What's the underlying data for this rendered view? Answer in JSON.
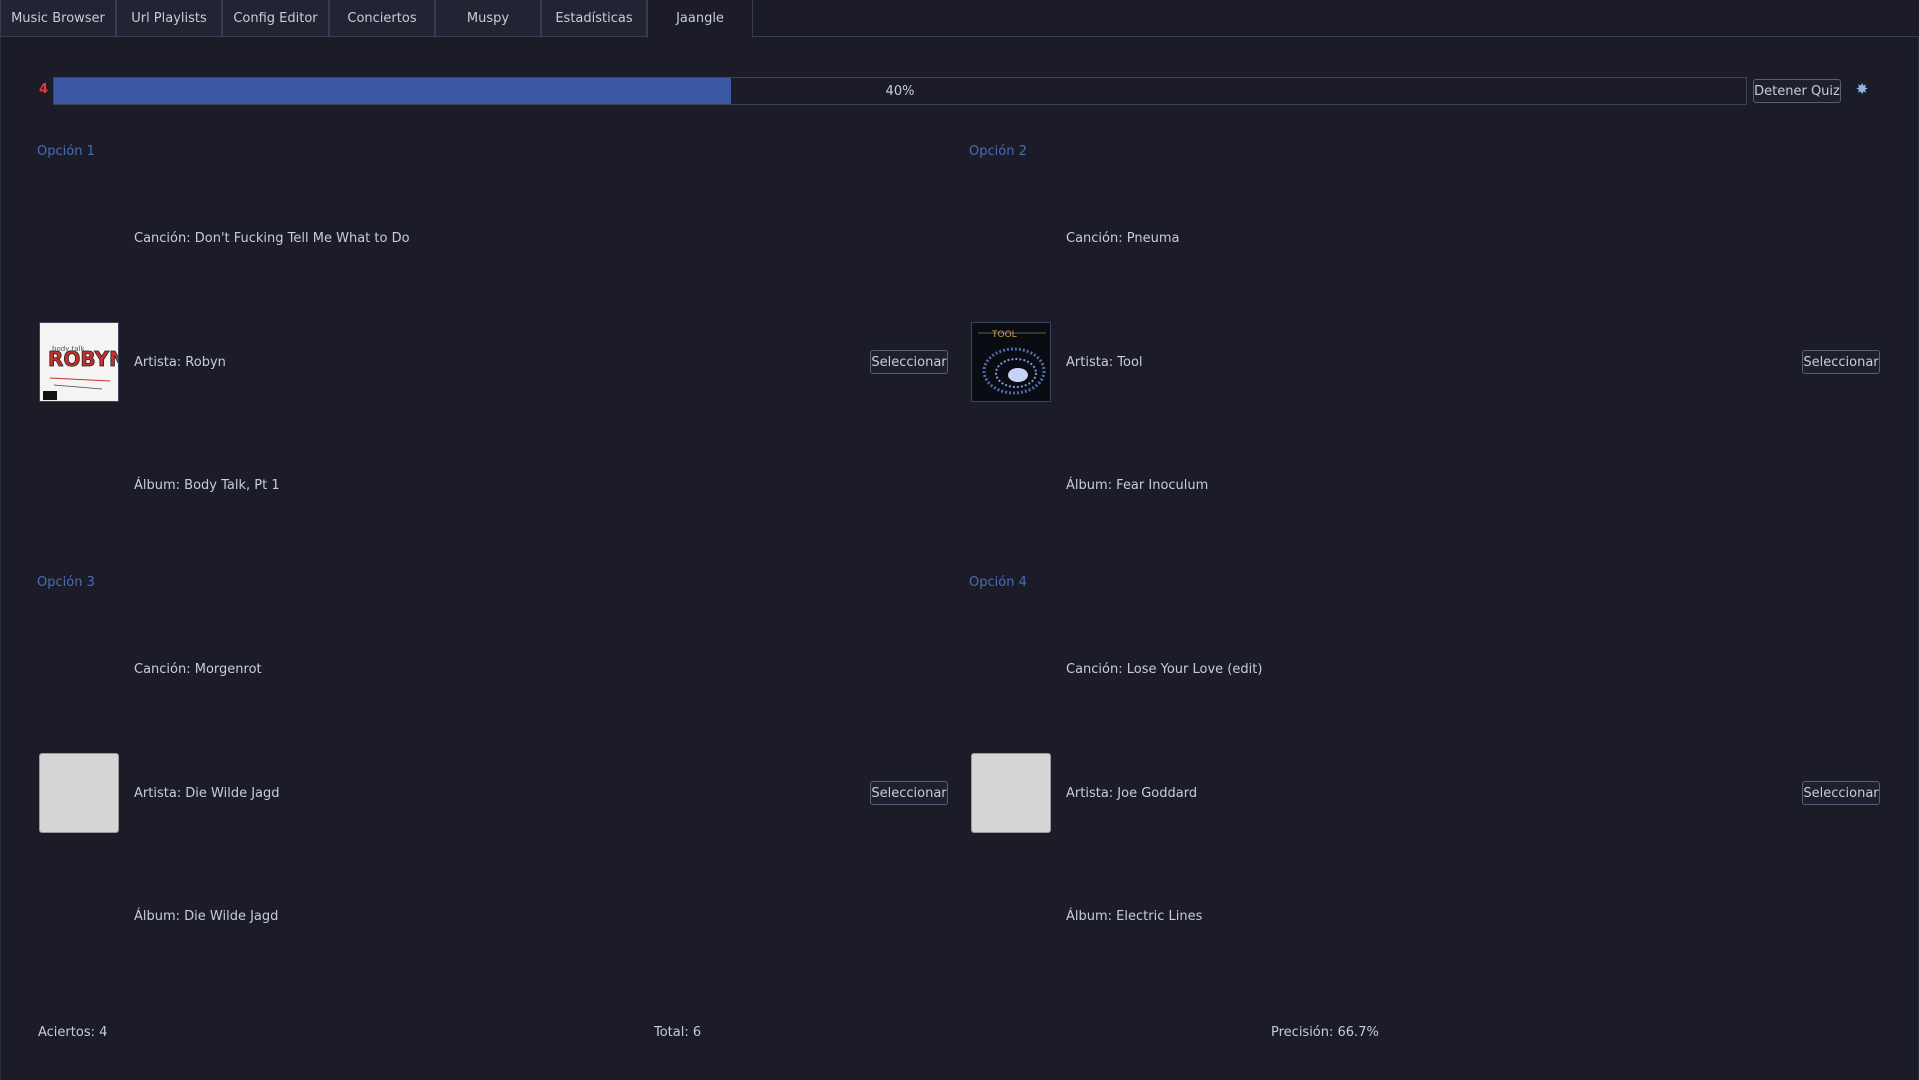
{
  "tabs": [
    {
      "label": "Music Browser",
      "active": false
    },
    {
      "label": "Url Playlists",
      "active": false
    },
    {
      "label": "Config Editor",
      "active": false
    },
    {
      "label": "Conciertos",
      "active": false
    },
    {
      "label": "Muspy",
      "active": false
    },
    {
      "label": "Estadísticas",
      "active": false
    },
    {
      "label": "Jaangle",
      "active": true
    }
  ],
  "quiz": {
    "counter": "4",
    "progress_label": "40%",
    "progress_value": 0.4,
    "stop_label": "Detener Quiz",
    "settings_icon": "gear-icon"
  },
  "options": [
    {
      "title": "Opción 1",
      "song": "Canción: Don't Fucking Tell Me What to Do",
      "artist": "Artista: Robyn",
      "album": "Álbum: Body Talk, Pt 1",
      "select_label": "Seleccionar",
      "cover": "robyn-cover"
    },
    {
      "title": "Opción 2",
      "song": "Canción: Pneuma",
      "artist": "Artista: Tool",
      "album": "Álbum: Fear Inoculum",
      "select_label": "Seleccionar",
      "cover": "tool-cover"
    },
    {
      "title": "Opción 3",
      "song": "Canción: Morgenrot",
      "artist": "Artista: Die Wilde Jagd",
      "album": "Álbum: Die Wilde Jagd",
      "select_label": "Seleccionar",
      "cover": "blank"
    },
    {
      "title": "Opción 4",
      "song": "Canción: Lose Your Love (edit)",
      "artist": "Artista: Joe Goddard",
      "album": "Álbum: Electric Lines",
      "select_label": "Seleccionar",
      "cover": "blank"
    }
  ],
  "stats": {
    "aciertos": "Aciertos: 4",
    "total": "Total: 6",
    "precision": "Precisión: 66.7%"
  }
}
